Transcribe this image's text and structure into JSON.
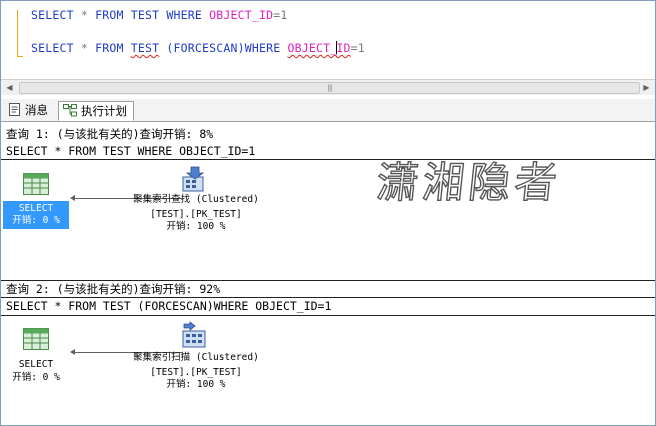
{
  "editor": {
    "line1": {
      "select": "SELECT",
      "star": "*",
      "from": "FROM",
      "table": "TEST",
      "where": "WHERE",
      "column": "OBJECT_ID",
      "eq": "=1"
    },
    "line2": {
      "select": "SELECT",
      "star": "*",
      "from": "FROM",
      "table": "TEST",
      "hint": "(FORCESCAN)",
      "where": "WHERE",
      "column_a": "OBJECT_",
      "column_b": "ID",
      "eq": "=1"
    }
  },
  "tabs": [
    {
      "label": "消息",
      "icon": "messages-icon",
      "active": false
    },
    {
      "label": "执行计划",
      "icon": "execution-plan-icon",
      "active": true
    }
  ],
  "plan": {
    "watermark": "潇湘隐者",
    "queries": [
      {
        "header": "查询 1: (与该批有关的)查询开销: 8%",
        "sql": "SELECT * FROM TEST WHERE OBJECT_ID=1",
        "select_node": {
          "title": "SELECT",
          "cost": "开销: 0 %"
        },
        "op_node": {
          "line1": "聚集索引查找 (Clustered)",
          "line2": "[TEST].[PK_TEST]",
          "line3": "开销: 100 %",
          "icon": "clustered-index-seek-icon"
        }
      },
      {
        "header": "查询 2: (与该批有关的)查询开销: 92%",
        "sql": "SELECT * FROM TEST (FORCESCAN)WHERE OBJECT_ID=1",
        "select_node": {
          "title": "SELECT",
          "cost": "开销: 0 %"
        },
        "op_node": {
          "line1": "聚集索引扫描 (Clustered)",
          "line2": "[TEST].[PK_TEST]",
          "line3": "开销: 100 %",
          "icon": "clustered-index-scan-icon"
        }
      }
    ]
  },
  "colors": {
    "keyword": "#1e3cc8",
    "column": "#e020c0",
    "operator": "#7a7a7a",
    "selection": "#3399ff"
  }
}
